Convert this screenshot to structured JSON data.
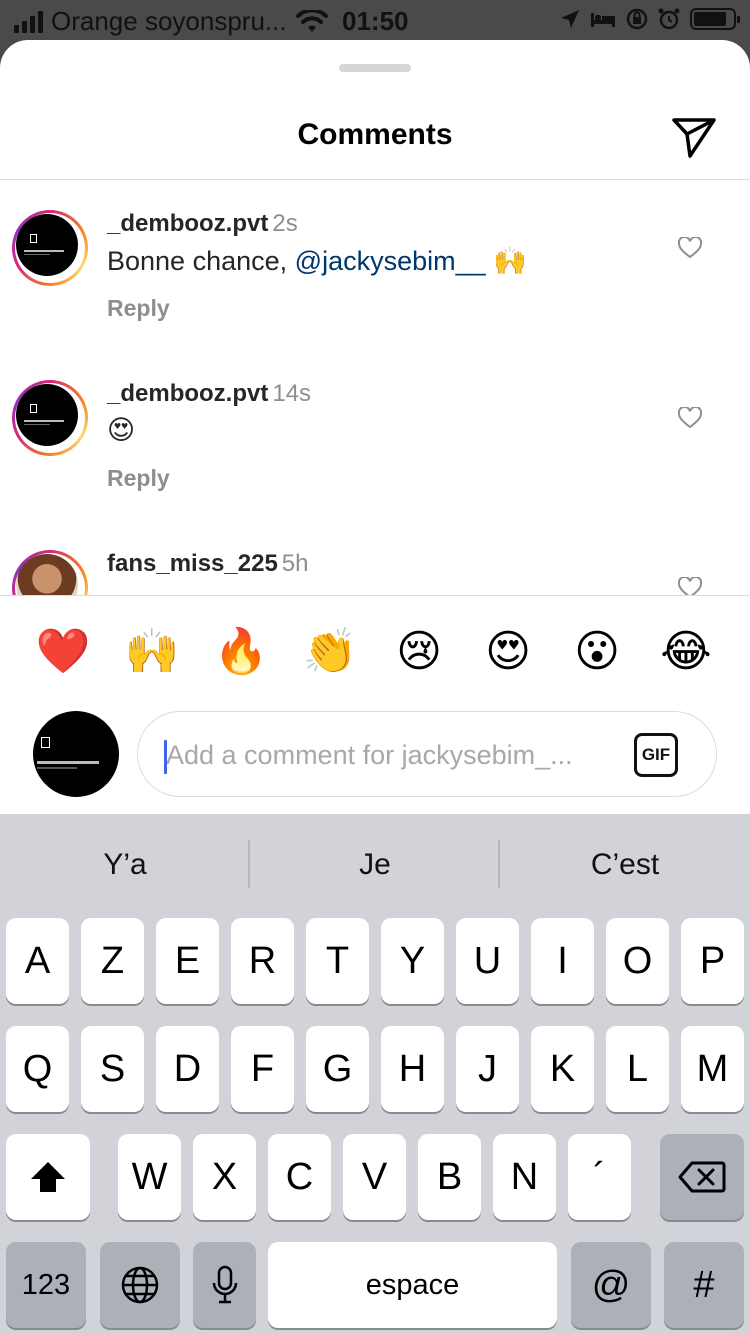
{
  "status_bar": {
    "carrier": "Orange soyonspru...",
    "time": "01:50",
    "battery_level": 0.85
  },
  "header": {
    "title": "Comments"
  },
  "comments": [
    {
      "username": "_dembooz.pvt",
      "time": "2s",
      "text": "Bonne chance, ",
      "mention": "@jackysebim__",
      "emoji": "🙌",
      "reply_label": "Reply"
    },
    {
      "username": "_dembooz.pvt",
      "time": "14s",
      "text": "😍",
      "reply_label": "Reply"
    },
    {
      "username": "fans_miss_225",
      "time": "5h"
    }
  ],
  "emoji_reactions": [
    "❤️",
    "🙌",
    "🔥",
    "👏",
    "😢",
    "😍",
    "😮",
    "😂"
  ],
  "composer": {
    "placeholder": "Add a comment for jackysebim_...",
    "gif_label": "GIF"
  },
  "keyboard": {
    "suggestions": [
      "Y’a",
      "Je",
      "C’est"
    ],
    "row1": [
      "A",
      "Z",
      "E",
      "R",
      "T",
      "Y",
      "U",
      "I",
      "O",
      "P"
    ],
    "row2": [
      "Q",
      "S",
      "D",
      "F",
      "G",
      "H",
      "J",
      "K",
      "L",
      "M"
    ],
    "row3": [
      "W",
      "X",
      "C",
      "V",
      "B",
      "N",
      "´"
    ],
    "numbers_label": "123",
    "space_label": "espace",
    "at_label": "@",
    "hash_label": "#"
  },
  "colors": {
    "mention": "#00376b",
    "secondary_text": "#8e8e8e",
    "caret": "#3d65f0",
    "keyboard_bg": "#d1d3d9"
  },
  "icons": [
    "signal-icon",
    "wifi-icon",
    "location-icon",
    "bed-icon",
    "orientation-lock-icon",
    "alarm-icon",
    "battery-icon",
    "send-icon",
    "heart-icon",
    "shift-icon",
    "backspace-icon",
    "globe-icon",
    "microphone-icon"
  ]
}
